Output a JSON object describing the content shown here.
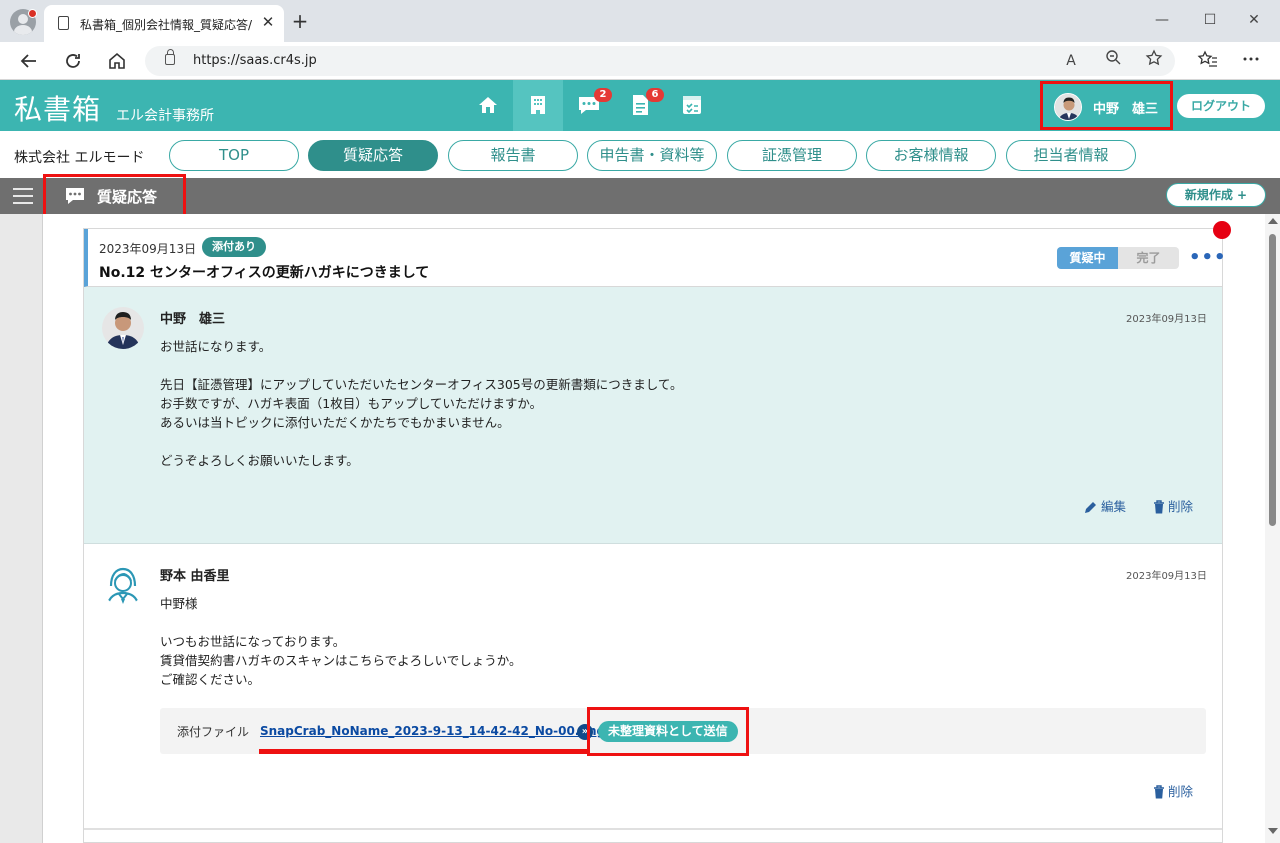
{
  "browser": {
    "tab_title": "私書箱_個別会社情報_質疑応答/",
    "tab_close": "✕",
    "new_tab": "+",
    "url": "https://saas.cr4s.jp",
    "read_aloud": "A",
    "win_min": "—",
    "win_max": "☐",
    "win_close": "✕"
  },
  "app": {
    "logo": "私書箱",
    "firm_name": "エル会計事務所",
    "nav_badges": {
      "messages": "2",
      "reports": "6"
    },
    "user_name": "中野　雄三",
    "logout_label": "ログアウト"
  },
  "company": {
    "name": "株式会社 エルモード",
    "tabs": [
      {
        "label": "TOP"
      },
      {
        "label": "質疑応答"
      },
      {
        "label": "報告書"
      },
      {
        "label": "申告書・資料等"
      },
      {
        "label": "証憑管理"
      },
      {
        "label": "お客様情報"
      },
      {
        "label": "担当者情報"
      }
    ]
  },
  "section": {
    "title": "質疑応答",
    "new_label": "新規作成 +"
  },
  "topic": {
    "date": "2023年09月13日",
    "attach_badge": "添付あり",
    "title": "No.12 センターオフィスの更新ハガキにつきまして",
    "status_active": "質疑中",
    "status_done": "完了",
    "more": "•••"
  },
  "messages": [
    {
      "author": "中野　雄三",
      "date": "2023年09月13日",
      "lines": [
        "お世話になります。",
        "",
        "先日【証憑管理】にアップしていただいたセンターオフィス305号の更新書類につきまして。",
        "お手数ですが、ハガキ表面（1枚目）もアップしていただけますか。",
        "あるいは当トピックに添付いただくかたちでもかまいません。",
        "",
        "どうぞよろしくお願いいたします。"
      ],
      "edit_label": "編集",
      "delete_label": "削除"
    },
    {
      "author": "野本 由香里",
      "date": "2023年09月13日",
      "lines": [
        "中野様",
        "",
        "いつもお世話になっております。",
        "賃貸借契約書ハガキのスキャンはこちらでよろしいでしょうか。",
        "ご確認ください。"
      ],
      "attach_label": "添付ファイル",
      "attach_file": "SnapCrab_NoName_2023-9-13_14-42-42_No-00.png",
      "ext_icon": "»",
      "send_label": "未整理資料として送信",
      "delete_label": "削除"
    }
  ]
}
